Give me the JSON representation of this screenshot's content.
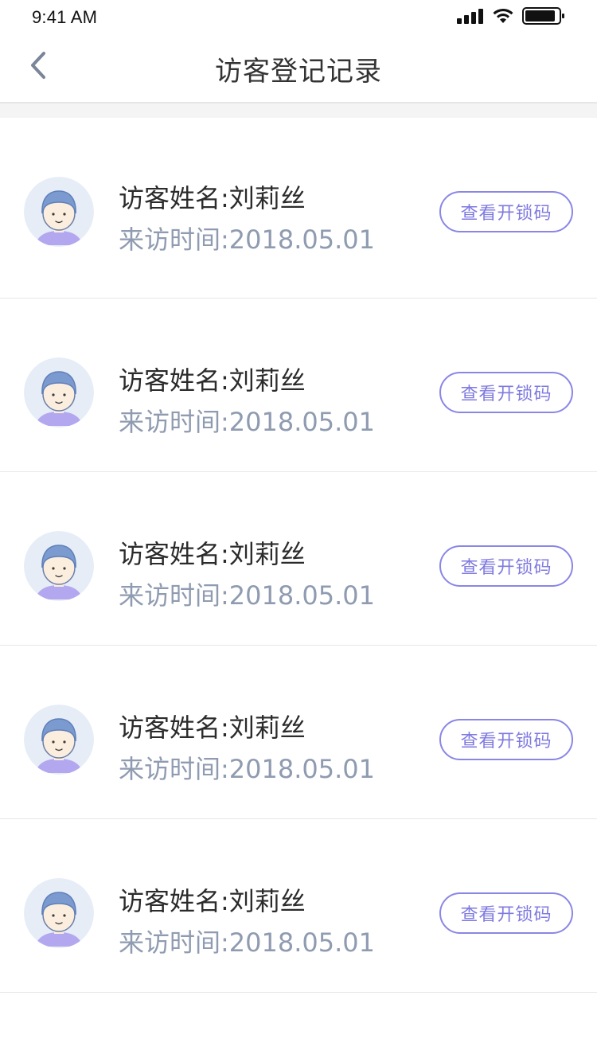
{
  "status_bar": {
    "time": "9:41 AM"
  },
  "nav": {
    "title": "访客登记记录",
    "back_icon": "chevron-left-icon"
  },
  "visitors": [
    {
      "name_label": "访客姓名:",
      "name": "刘莉丝",
      "time_label": "来访时间:",
      "time": "2018.05.01",
      "button_label": "查看开锁码"
    },
    {
      "name_label": "访客姓名:",
      "name": "刘莉丝",
      "time_label": "来访时间:",
      "time": "2018.05.01",
      "button_label": "查看开锁码"
    },
    {
      "name_label": "访客姓名:",
      "name": "刘莉丝",
      "time_label": "来访时间:",
      "time": "2018.05.01",
      "button_label": "查看开锁码"
    },
    {
      "name_label": "访客姓名:",
      "name": "刘莉丝",
      "time_label": "来访时间:",
      "time": "2018.05.01",
      "button_label": "查看开锁码"
    },
    {
      "name_label": "访客姓名:",
      "name": "刘莉丝",
      "time_label": "来访时间:",
      "time": "2018.05.01",
      "button_label": "查看开锁码"
    }
  ],
  "colors": {
    "accent": "#7f7ae0",
    "secondary_text": "#8f9bb0",
    "avatar_bg": "#e6edf7",
    "avatar_hair": "#7b9bd0",
    "avatar_shirt": "#b3a8f0"
  }
}
